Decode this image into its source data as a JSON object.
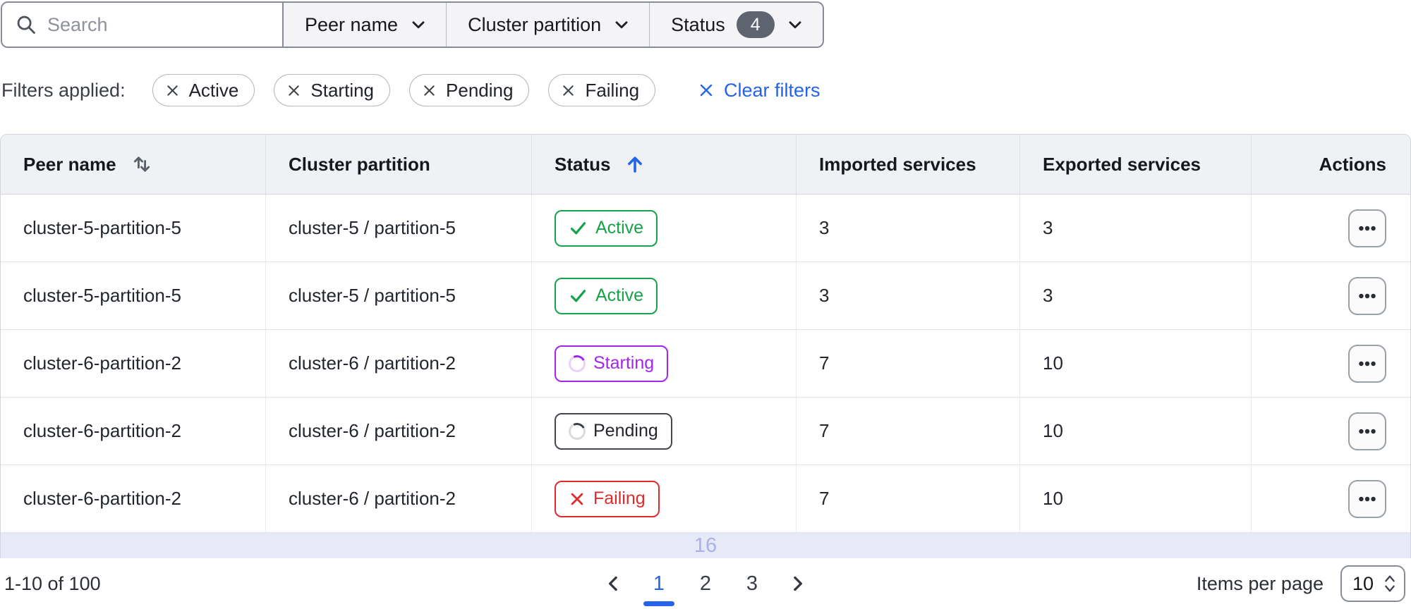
{
  "filter_bar": {
    "search_placeholder": "Search",
    "dropdowns": [
      {
        "label": "Peer name"
      },
      {
        "label": "Cluster partition"
      },
      {
        "label": "Status",
        "badge_count": "4"
      }
    ]
  },
  "filters": {
    "label": "Filters applied:",
    "chips": [
      "Active",
      "Starting",
      "Pending",
      "Failing"
    ],
    "clear_label": "Clear filters"
  },
  "table": {
    "columns": [
      "Peer name",
      "Cluster partition",
      "Status",
      "Imported services",
      "Exported services",
      "Actions"
    ],
    "sort": {
      "peer_name": "unsorted",
      "status": "ascending"
    },
    "rows": [
      {
        "peer_name": "cluster-5-partition-5",
        "cluster_partition": "cluster-5 / partition-5",
        "status": "Active",
        "imported": "3",
        "exported": "3"
      },
      {
        "peer_name": "cluster-5-partition-5",
        "cluster_partition": "cluster-5 / partition-5",
        "status": "Active",
        "imported": "3",
        "exported": "3"
      },
      {
        "peer_name": "cluster-6-partition-2",
        "cluster_partition": "cluster-6 / partition-2",
        "status": "Starting",
        "imported": "7",
        "exported": "10"
      },
      {
        "peer_name": "cluster-6-partition-2",
        "cluster_partition": "cluster-6 / partition-2",
        "status": "Pending",
        "imported": "7",
        "exported": "10"
      },
      {
        "peer_name": "cluster-6-partition-2",
        "cluster_partition": "cluster-6 / partition-2",
        "status": "Failing",
        "imported": "7",
        "exported": "10"
      }
    ],
    "partial_row_text": "16"
  },
  "pagination": {
    "range_label": "1-10 of 100",
    "pages": [
      "1",
      "2",
      "3"
    ],
    "current_page": "1",
    "items_per_page_label": "Items per page",
    "items_per_page_value": "10"
  },
  "colors": {
    "status_active": "#16a34a",
    "status_starting": "#a325ee",
    "status_pending_border": "#43474f",
    "status_failing": "#df2b2b",
    "link_blue": "#2563eb",
    "count_badge_bg": "#5d6470",
    "partial_row_bg": "#e7e8f8",
    "partial_row_text": "#a9b1e8"
  }
}
